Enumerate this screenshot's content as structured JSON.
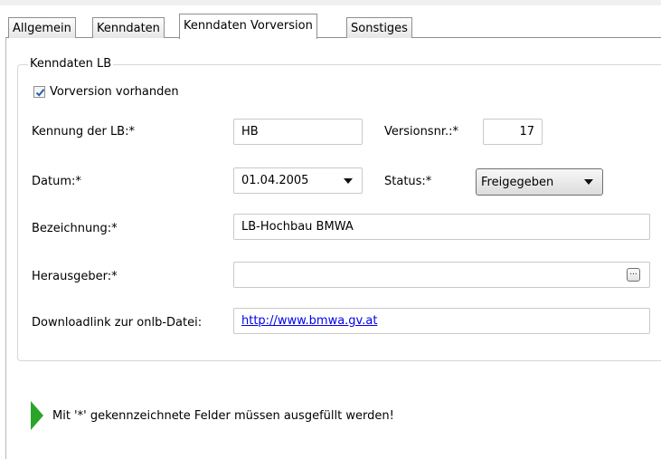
{
  "tabs": [
    {
      "label": "Allgemein"
    },
    {
      "label": "Kenndaten"
    },
    {
      "label": "Kenndaten Vorversion",
      "active": true
    },
    {
      "label": "Sonstiges"
    }
  ],
  "group": {
    "title": "Kenndaten LB",
    "checkbox": {
      "label": "Vorversion vorhanden",
      "checked": true
    },
    "fields": {
      "kennung": {
        "label": "Kennung der LB:*",
        "value": "HB"
      },
      "versionsnr": {
        "label": "Versionsnr.:*",
        "value": "17"
      },
      "datum": {
        "label": "Datum:*",
        "value": "01.04.2005"
      },
      "status": {
        "label": "Status:*",
        "value": "Freigegeben"
      },
      "bezeichnung": {
        "label": "Bezeichnung:*",
        "value": "LB-Hochbau BMWA"
      },
      "herausgeber": {
        "label": "Herausgeber:*",
        "value": "",
        "button_label": "..."
      },
      "downloadlink": {
        "label": "Downloadlink zur onlb-Datei:",
        "value": "http://www.bmwa.gv.at"
      }
    }
  },
  "info": {
    "message": "Mit '*' gekennzeichnete Felder müssen ausgefüllt werden!",
    "icon": "green-arrow-icon"
  },
  "colors": {
    "info_arrow": "#2aa52a",
    "link": "#0000ee",
    "checkmark": "#2a5fb0"
  }
}
